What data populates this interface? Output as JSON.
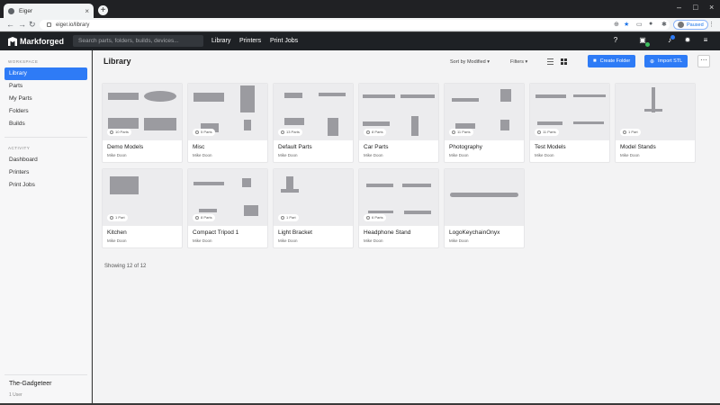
{
  "browser": {
    "tab_title": "Eiger",
    "url": "eiger.io/library",
    "profile_label": "Paused"
  },
  "header": {
    "logo_text": "Markforged",
    "search_placeholder": "Search parts, folders, builds, devices...",
    "nav": [
      "Library",
      "Printers",
      "Print Jobs"
    ]
  },
  "sidebar": {
    "workspace_label": "WORKSPACE",
    "workspace_items": [
      {
        "label": "Library",
        "active": true
      },
      {
        "label": "Parts",
        "active": false
      },
      {
        "label": "My Parts",
        "active": false
      },
      {
        "label": "Folders",
        "active": false
      },
      {
        "label": "Builds",
        "active": false
      }
    ],
    "activity_label": "ACTIVITY",
    "activity_items": [
      {
        "label": "Dashboard"
      },
      {
        "label": "Printers"
      },
      {
        "label": "Print Jobs"
      }
    ],
    "org_name": "The-Gadgeteer",
    "org_sub": "1 User"
  },
  "main": {
    "title": "Library",
    "sort_label": "Sort by Modified",
    "filters_label": "Filters",
    "create_folder_label": "Create Folder",
    "import_stl_label": "Import STL",
    "showing_text": "Showing 12 of 12"
  },
  "cards": [
    {
      "name": "Demo Models",
      "owner": "Mike Doon",
      "count": "10 Parts"
    },
    {
      "name": "Misc",
      "owner": "Mike Doon",
      "count": "5 Parts"
    },
    {
      "name": "Default Parts",
      "owner": "Mike Doon",
      "count": "13 Parts"
    },
    {
      "name": "Car Parts",
      "owner": "Mike Doon",
      "count": "8 Parts"
    },
    {
      "name": "Photography",
      "owner": "Mike Doon",
      "count": "11 Parts"
    },
    {
      "name": "Test Models",
      "owner": "Mike Doon",
      "count": "11 Parts"
    },
    {
      "name": "Model Stands",
      "owner": "Mike Doon",
      "count": "1 Part"
    },
    {
      "name": "Kitchen",
      "owner": "Mike Doon",
      "count": "1 Part"
    },
    {
      "name": "Compact Tripod 1",
      "owner": "Mike Doon",
      "count": "8 Parts"
    },
    {
      "name": "Light Bracket",
      "owner": "Mike Doon",
      "count": "1 Part"
    },
    {
      "name": "Headphone Stand",
      "owner": "Mike Doon",
      "count": "6 Parts"
    },
    {
      "name": "LogoKeychainOnyx",
      "owner": "Mike Doon",
      "count": ""
    }
  ],
  "colors": {
    "accent": "#2e7bf6",
    "appbar": "#1e2125",
    "sidebar_bg": "#f7f7f8",
    "main_bg": "#f3f3f4"
  }
}
